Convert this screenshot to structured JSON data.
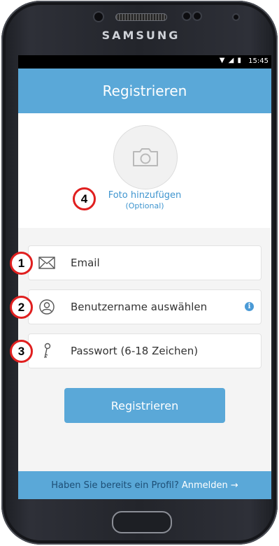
{
  "device": {
    "brand": "SAMSUNG",
    "status_icons": "▼ ◢ ▮",
    "time": "15:45"
  },
  "header": {
    "title": "Registrieren"
  },
  "photo": {
    "add_label": "Foto hinzufügen",
    "optional_label": "(Optional)"
  },
  "form": {
    "fields": [
      {
        "label": "Email",
        "icon": "envelope-icon"
      },
      {
        "label": "Benutzername auswählen",
        "icon": "user-icon",
        "info": "i"
      },
      {
        "label": "Passwort (6-18 Zeichen)",
        "icon": "key-icon"
      }
    ],
    "submit_label": "Registrieren"
  },
  "footer": {
    "question": "Haben Sie bereits ein Profil?",
    "link": "Anmelden →"
  },
  "annotations": [
    "1",
    "2",
    "3",
    "4"
  ],
  "colors": {
    "primary": "#5aa8d8",
    "link": "#3f95cf",
    "badge_border": "#e01f1f"
  }
}
